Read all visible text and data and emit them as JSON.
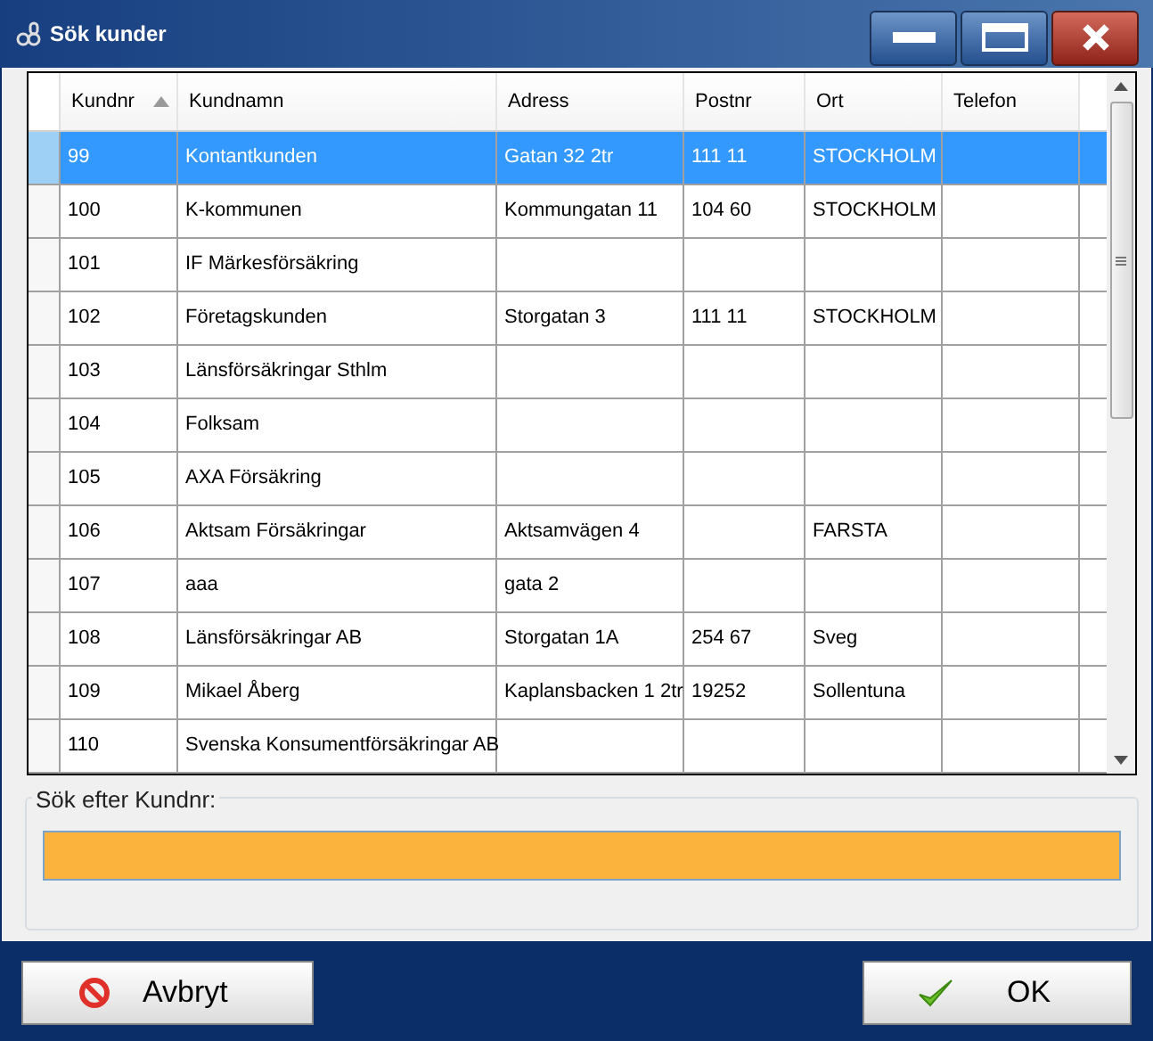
{
  "window": {
    "title": "Sök kunder"
  },
  "table": {
    "columns": [
      {
        "label": "Kundnr",
        "sorted": true
      },
      {
        "label": "Kundnamn",
        "sorted": false
      },
      {
        "label": "Adress",
        "sorted": false
      },
      {
        "label": "Postnr",
        "sorted": false
      },
      {
        "label": "Ort",
        "sorted": false
      },
      {
        "label": "Telefon",
        "sorted": false
      }
    ],
    "rows": [
      {
        "selected": true,
        "cells": [
          "99",
          "Kontantkunden",
          "Gatan 32 2tr",
          "111 11",
          "STOCKHOLM",
          ""
        ]
      },
      {
        "selected": false,
        "cells": [
          "100",
          "K-kommunen",
          "Kommungatan 11",
          "104 60",
          "STOCKHOLM",
          ""
        ]
      },
      {
        "selected": false,
        "cells": [
          "101",
          "IF Märkesförsäkring",
          "",
          "",
          "",
          ""
        ]
      },
      {
        "selected": false,
        "cells": [
          "102",
          "Företagskunden",
          "Storgatan 3",
          "111 11",
          "STOCKHOLM",
          ""
        ]
      },
      {
        "selected": false,
        "cells": [
          "103",
          "Länsförsäkringar Sthlm",
          "",
          "",
          "",
          ""
        ]
      },
      {
        "selected": false,
        "cells": [
          "104",
          "Folksam",
          "",
          "",
          "",
          ""
        ]
      },
      {
        "selected": false,
        "cells": [
          "105",
          "AXA Försäkring",
          "",
          "",
          "",
          ""
        ]
      },
      {
        "selected": false,
        "cells": [
          "106",
          "Aktsam Försäkringar",
          "Aktsamvägen 4",
          "",
          "FARSTA",
          ""
        ]
      },
      {
        "selected": false,
        "cells": [
          "107",
          "aaa",
          "gata 2",
          "",
          "",
          ""
        ]
      },
      {
        "selected": false,
        "cells": [
          "108",
          "Länsförsäkringar AB",
          "Storgatan 1A",
          "254 67",
          "Sveg",
          ""
        ]
      },
      {
        "selected": false,
        "cells": [
          "109",
          "Mikael Åberg",
          "Kaplansbacken 1 2tr",
          "19252",
          "Sollentuna",
          ""
        ]
      },
      {
        "selected": false,
        "cells": [
          "110",
          "Svenska Konsumentförsäkringar AB",
          "",
          "",
          "",
          ""
        ]
      }
    ]
  },
  "search": {
    "label": "Sök efter Kundnr:"
  },
  "buttons": [
    {
      "label": "Avbryt",
      "kind": "cancel"
    },
    {
      "label": "OK",
      "kind": "ok"
    }
  ]
}
